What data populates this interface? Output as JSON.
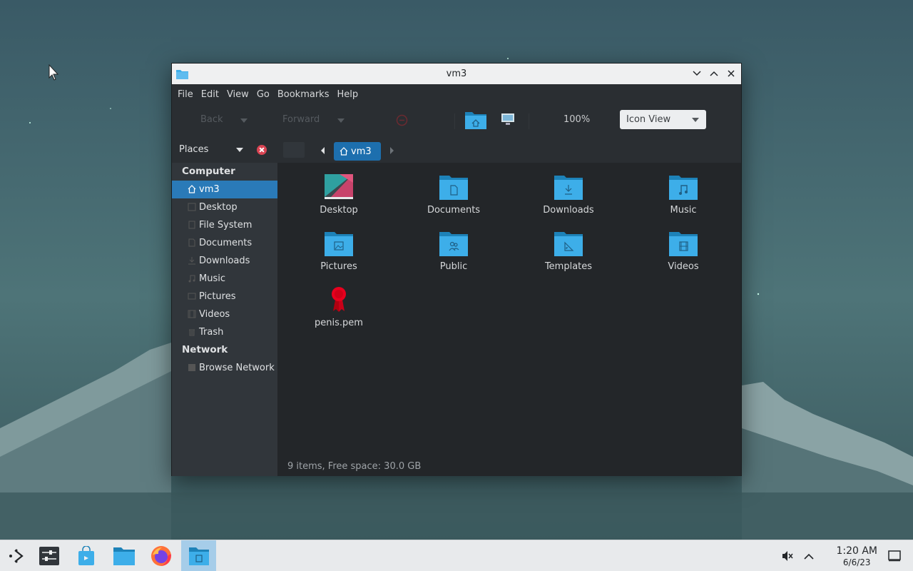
{
  "window": {
    "title": "vm3",
    "menu": [
      "File",
      "Edit",
      "View",
      "Go",
      "Bookmarks",
      "Help"
    ],
    "toolbar": {
      "back_label": "Back",
      "forward_label": "Forward",
      "zoom": "100%",
      "view_mode": "Icon View"
    }
  },
  "sidebar": {
    "header": "Places",
    "sections": [
      {
        "title": "Computer",
        "items": [
          {
            "label": "vm3",
            "icon": "home-icon",
            "selected": true
          },
          {
            "label": "Desktop",
            "icon": "desktop-icon"
          },
          {
            "label": "File System",
            "icon": "drive-icon"
          },
          {
            "label": "Documents",
            "icon": "documents-icon"
          },
          {
            "label": "Downloads",
            "icon": "downloads-icon"
          },
          {
            "label": "Music",
            "icon": "music-icon"
          },
          {
            "label": "Pictures",
            "icon": "pictures-icon"
          },
          {
            "label": "Videos",
            "icon": "videos-icon"
          },
          {
            "label": "Trash",
            "icon": "trash-icon"
          }
        ]
      },
      {
        "title": "Network",
        "items": [
          {
            "label": "Browse Network",
            "icon": "network-icon"
          }
        ]
      }
    ]
  },
  "pathbar": {
    "crumb": "vm3"
  },
  "files": [
    {
      "name": "Desktop",
      "icon": "desktop-folder-icon"
    },
    {
      "name": "Documents",
      "icon": "documents-folder-icon"
    },
    {
      "name": "Downloads",
      "icon": "downloads-folder-icon"
    },
    {
      "name": "Music",
      "icon": "music-folder-icon"
    },
    {
      "name": "Pictures",
      "icon": "pictures-folder-icon"
    },
    {
      "name": "Public",
      "icon": "public-folder-icon"
    },
    {
      "name": "Templates",
      "icon": "templates-folder-icon"
    },
    {
      "name": "Videos",
      "icon": "videos-folder-icon"
    },
    {
      "name": "penis.pem",
      "icon": "certificate-icon"
    }
  ],
  "status": "9 items, Free space: 30.0 GB",
  "taskbar": {
    "apps": [
      "application-launcher",
      "system-settings",
      "discover",
      "file-manager",
      "firefox",
      "pcmanfm-active"
    ],
    "time": "1:20 AM",
    "date": "6/6/23"
  },
  "colors": {
    "accent": "#2a7ab8",
    "folder": "#3daee9",
    "titlebar": "#eff0f1",
    "taskbar": "#e8eaec"
  }
}
